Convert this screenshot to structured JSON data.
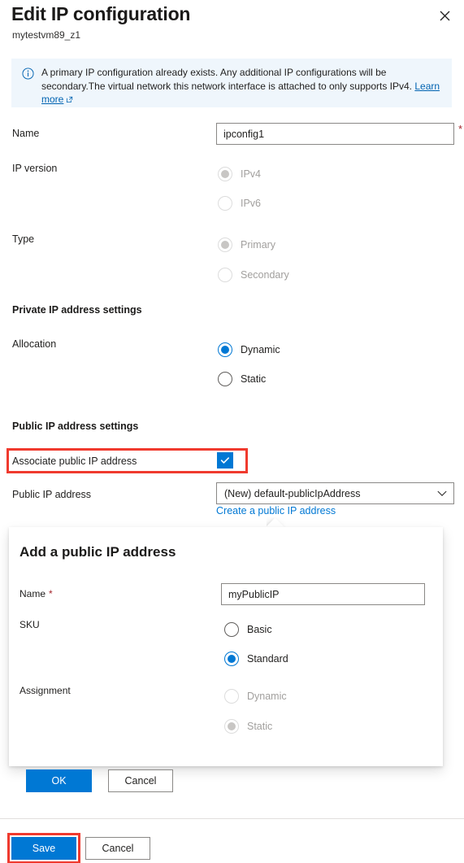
{
  "header": {
    "title": "Edit IP configuration",
    "subtitle": "mytestvm89_z1",
    "close_icon": "close-icon"
  },
  "banner": {
    "icon": "info-icon",
    "text": "A primary IP configuration already exists. Any additional IP configurations will be secondary.The virtual network this network interface is attached to only supports IPv4.",
    "link_text": "Learn more",
    "external_icon": "external-link-icon",
    "background": "#eff6fc",
    "link_color": "#0063b1"
  },
  "form": {
    "name": {
      "label": "Name",
      "value": "ipconfig1",
      "placeholder": "",
      "required_marker": "*"
    },
    "ip_version": {
      "label": "IP version",
      "options": [
        {
          "label": "IPv4",
          "selected": true,
          "disabled": true
        },
        {
          "label": "IPv6",
          "selected": false,
          "disabled": true
        }
      ]
    },
    "type": {
      "label": "Type",
      "options": [
        {
          "label": "Primary",
          "selected": true,
          "disabled": true
        },
        {
          "label": "Secondary",
          "selected": false,
          "disabled": true
        }
      ]
    },
    "private_section": {
      "heading": "Private IP address settings"
    },
    "allocation": {
      "label": "Allocation",
      "options": [
        {
          "label": "Dynamic",
          "selected": true,
          "disabled": false
        },
        {
          "label": "Static",
          "selected": false,
          "disabled": false
        }
      ]
    },
    "public_section": {
      "heading": "Public IP address settings"
    },
    "associate": {
      "label": "Associate public IP address",
      "checked": true,
      "check_icon": "checkmark-icon",
      "highlight_color": "#f03a2e"
    },
    "public_ip": {
      "label": "Public IP address",
      "selected_option": "(New) default-publicIpAddress",
      "chevron_icon": "chevron-down-icon",
      "create_link": "Create a public IP address"
    }
  },
  "dialog": {
    "title": "Add a public IP address",
    "name": {
      "label": "Name",
      "required_marker": "*",
      "value": "myPublicIP",
      "placeholder": ""
    },
    "sku": {
      "label": "SKU",
      "options": [
        {
          "label": "Basic",
          "selected": false,
          "disabled": false
        },
        {
          "label": "Standard",
          "selected": true,
          "disabled": false
        }
      ]
    },
    "assignment": {
      "label": "Assignment",
      "options": [
        {
          "label": "Dynamic",
          "selected": false,
          "disabled": true
        },
        {
          "label": "Static",
          "selected": true,
          "disabled": true
        }
      ]
    },
    "ok_label": "OK",
    "cancel_label": "Cancel"
  },
  "footer": {
    "save_label": "Save",
    "cancel_label": "Cancel",
    "highlight_color": "#f03a2e"
  },
  "colors": {
    "accent": "#0078d4",
    "highlight": "#f03a2e",
    "required": "#a4262c",
    "banner_bg": "#eff6fc"
  }
}
